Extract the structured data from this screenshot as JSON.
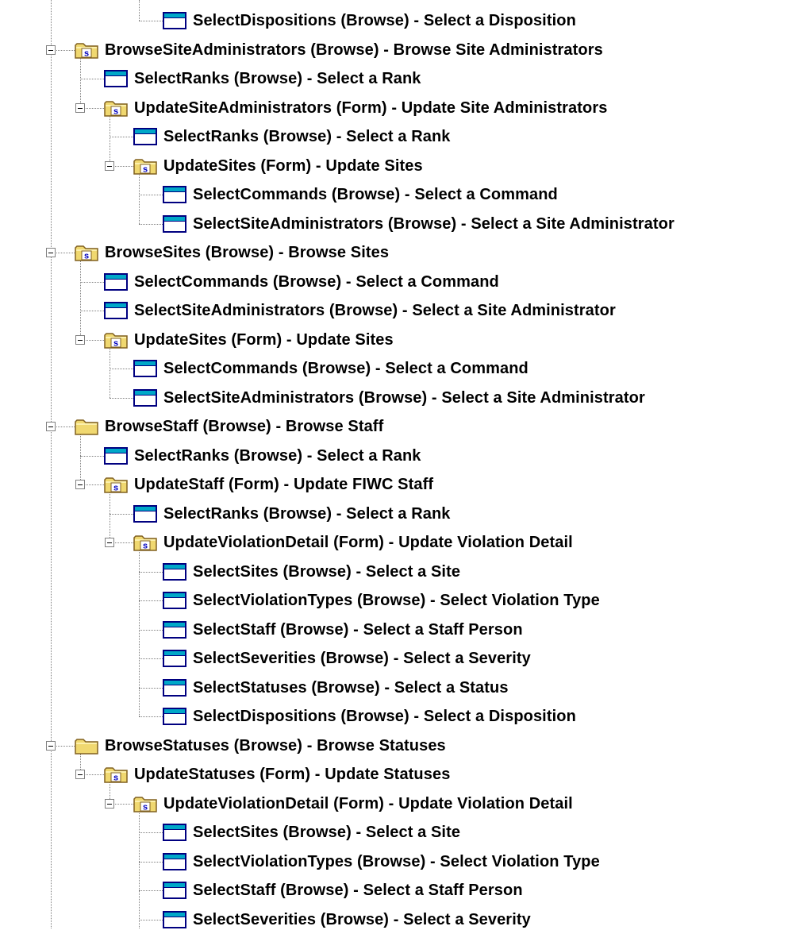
{
  "tree": {
    "rows": [
      {
        "label": "SelectDispositions (Browse) - Select a Disposition",
        "icon": "window-icon",
        "depth": 3,
        "expandable": false,
        "last": true
      },
      {
        "label": "BrowseSiteAdministrators (Browse) - Browse Site Administrators",
        "icon": "secure-folder-icon",
        "depth": 0,
        "expandable": true,
        "last": false
      },
      {
        "label": "SelectRanks (Browse) - Select a Rank",
        "icon": "window-icon",
        "depth": 1,
        "expandable": false,
        "last": false
      },
      {
        "label": "UpdateSiteAdministrators (Form) - Update Site Administrators",
        "icon": "secure-folder-icon",
        "depth": 1,
        "expandable": true,
        "last": true
      },
      {
        "label": "SelectRanks (Browse) - Select a Rank",
        "icon": "window-icon",
        "depth": 2,
        "expandable": false,
        "last": false
      },
      {
        "label": "UpdateSites (Form) - Update Sites",
        "icon": "secure-folder-icon",
        "depth": 2,
        "expandable": true,
        "last": true
      },
      {
        "label": "SelectCommands (Browse) - Select a Command",
        "icon": "window-icon",
        "depth": 3,
        "expandable": false,
        "last": false
      },
      {
        "label": "SelectSiteAdministrators (Browse) - Select a Site Administrator",
        "icon": "window-icon",
        "depth": 3,
        "expandable": false,
        "last": true
      },
      {
        "label": "BrowseSites (Browse) - Browse Sites",
        "icon": "secure-folder-icon",
        "depth": 0,
        "expandable": true,
        "last": false
      },
      {
        "label": "SelectCommands (Browse) - Select a Command",
        "icon": "window-icon",
        "depth": 1,
        "expandable": false,
        "last": false
      },
      {
        "label": "SelectSiteAdministrators (Browse) - Select a Site Administrator",
        "icon": "window-icon",
        "depth": 1,
        "expandable": false,
        "last": false
      },
      {
        "label": "UpdateSites (Form) - Update Sites",
        "icon": "secure-folder-icon",
        "depth": 1,
        "expandable": true,
        "last": true
      },
      {
        "label": "SelectCommands (Browse) - Select a Command",
        "icon": "window-icon",
        "depth": 2,
        "expandable": false,
        "last": false
      },
      {
        "label": "SelectSiteAdministrators (Browse) - Select a Site Administrator",
        "icon": "window-icon",
        "depth": 2,
        "expandable": false,
        "last": true
      },
      {
        "label": "BrowseStaff (Browse) - Browse Staff",
        "icon": "folder-icon",
        "depth": 0,
        "expandable": true,
        "last": false
      },
      {
        "label": "SelectRanks (Browse) - Select a Rank",
        "icon": "window-icon",
        "depth": 1,
        "expandable": false,
        "last": false
      },
      {
        "label": "UpdateStaff (Form) - Update FIWC Staff",
        "icon": "secure-folder-icon",
        "depth": 1,
        "expandable": true,
        "last": true
      },
      {
        "label": "SelectRanks (Browse) - Select a Rank",
        "icon": "window-icon",
        "depth": 2,
        "expandable": false,
        "last": false
      },
      {
        "label": "UpdateViolationDetail (Form) - Update Violation Detail",
        "icon": "secure-folder-icon",
        "depth": 2,
        "expandable": true,
        "last": true
      },
      {
        "label": "SelectSites (Browse) - Select a Site",
        "icon": "window-icon",
        "depth": 3,
        "expandable": false,
        "last": false
      },
      {
        "label": "SelectViolationTypes (Browse) - Select Violation Type",
        "icon": "window-icon",
        "depth": 3,
        "expandable": false,
        "last": false
      },
      {
        "label": "SelectStaff (Browse) - Select a Staff Person",
        "icon": "window-icon",
        "depth": 3,
        "expandable": false,
        "last": false
      },
      {
        "label": "SelectSeverities (Browse) - Select a Severity",
        "icon": "window-icon",
        "depth": 3,
        "expandable": false,
        "last": false
      },
      {
        "label": "SelectStatuses (Browse) - Select a Status",
        "icon": "window-icon",
        "depth": 3,
        "expandable": false,
        "last": false
      },
      {
        "label": "SelectDispositions (Browse) - Select a Disposition",
        "icon": "window-icon",
        "depth": 3,
        "expandable": false,
        "last": true
      },
      {
        "label": "BrowseStatuses (Browse) - Browse Statuses",
        "icon": "folder-icon",
        "depth": 0,
        "expandable": true,
        "last": false
      },
      {
        "label": "UpdateStatuses (Form) - Update Statuses",
        "icon": "secure-folder-icon",
        "depth": 1,
        "expandable": true,
        "last": true
      },
      {
        "label": "UpdateViolationDetail (Form) - Update Violation Detail",
        "icon": "secure-folder-icon",
        "depth": 2,
        "expandable": true,
        "last": true
      },
      {
        "label": "SelectSites (Browse) - Select a Site",
        "icon": "window-icon",
        "depth": 3,
        "expandable": false,
        "last": false
      },
      {
        "label": "SelectViolationTypes (Browse) - Select Violation Type",
        "icon": "window-icon",
        "depth": 3,
        "expandable": false,
        "last": false
      },
      {
        "label": "SelectStaff (Browse) - Select a Staff Person",
        "icon": "window-icon",
        "depth": 3,
        "expandable": false,
        "last": false
      },
      {
        "label": "SelectSeverities (Browse) - Select a Severity",
        "icon": "window-icon",
        "depth": 3,
        "expandable": false,
        "last": false
      }
    ]
  },
  "colors": {
    "connector": "#808080",
    "window_frame": "#000080",
    "window_title": "#00a8c8",
    "window_body": "#ffffff",
    "folder_fill": "#f0d870",
    "folder_edge": "#806020",
    "badge_text": "#0000c0"
  }
}
